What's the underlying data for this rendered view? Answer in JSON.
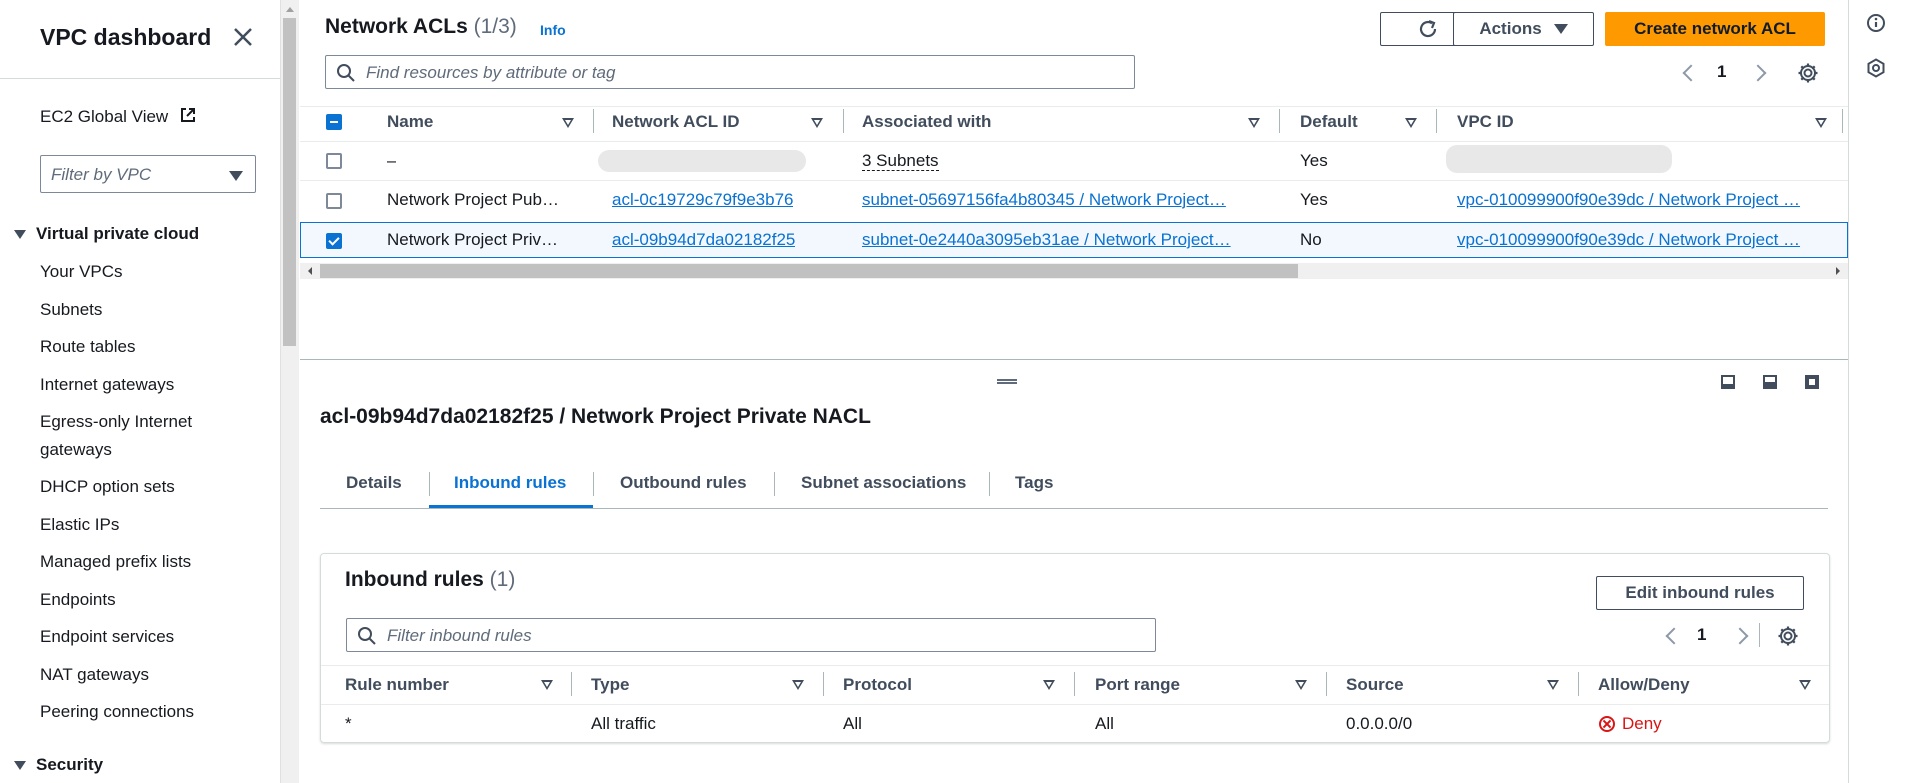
{
  "sidebar": {
    "title": "VPC dashboard",
    "global_view": "EC2 Global View",
    "filter_placeholder": "Filter by VPC",
    "section_vpc": "Virtual private cloud",
    "items": [
      "Your VPCs",
      "Subnets",
      "Route tables",
      "Internet gateways",
      "Egress-only Internet",
      "gateways",
      "DHCP option sets",
      "Elastic IPs",
      "Managed prefix lists",
      "Endpoints",
      "Endpoint services",
      "NAT gateways",
      "Peering connections"
    ],
    "section_security": "Security"
  },
  "header": {
    "title": "Network ACLs",
    "count": "(1/3)",
    "info": "Info",
    "actions_label": "Actions",
    "create_label": "Create network ACL",
    "search_placeholder": "Find resources by attribute or tag",
    "page": "1"
  },
  "table": {
    "columns": [
      "Name",
      "Network ACL ID",
      "Associated with",
      "Default",
      "VPC ID"
    ],
    "rows": [
      {
        "name": "–",
        "acl_id": "",
        "associated": "3 Subnets",
        "default": "Yes",
        "vpc": ""
      },
      {
        "name": "Network Project Pub…",
        "acl_id": "acl-0c19729c79f9e3b76",
        "associated": "subnet-05697156fa4b80345 / Network Project…",
        "default": "Yes",
        "vpc": "vpc-010099900f90e39dc / Network Project …"
      },
      {
        "name": "Network Project Priv…",
        "acl_id": "acl-09b94d7da02182f25",
        "associated": "subnet-0e2440a3095eb31ae / Network Project…",
        "default": "No",
        "vpc": "vpc-010099900f90e39dc / Network Project …"
      }
    ]
  },
  "detail": {
    "title": "acl-09b94d7da02182f25 / Network Project Private NACL",
    "tabs": [
      "Details",
      "Inbound rules",
      "Outbound rules",
      "Subnet associations",
      "Tags"
    ],
    "active_tab": "Inbound rules",
    "card_title": "Inbound rules",
    "card_count": "(1)",
    "edit_label": "Edit inbound rules",
    "filter_placeholder": "Filter inbound rules",
    "page": "1",
    "columns": [
      "Rule number",
      "Type",
      "Protocol",
      "Port range",
      "Source",
      "Allow/Deny"
    ],
    "rules": [
      {
        "rule": "*",
        "type": "All traffic",
        "protocol": "All",
        "port": "All",
        "source": "0.0.0.0/0",
        "action": "Deny"
      }
    ]
  },
  "colors": {
    "accent": "#0972d3",
    "primary": "#ff9900",
    "deny": "#d91515"
  }
}
